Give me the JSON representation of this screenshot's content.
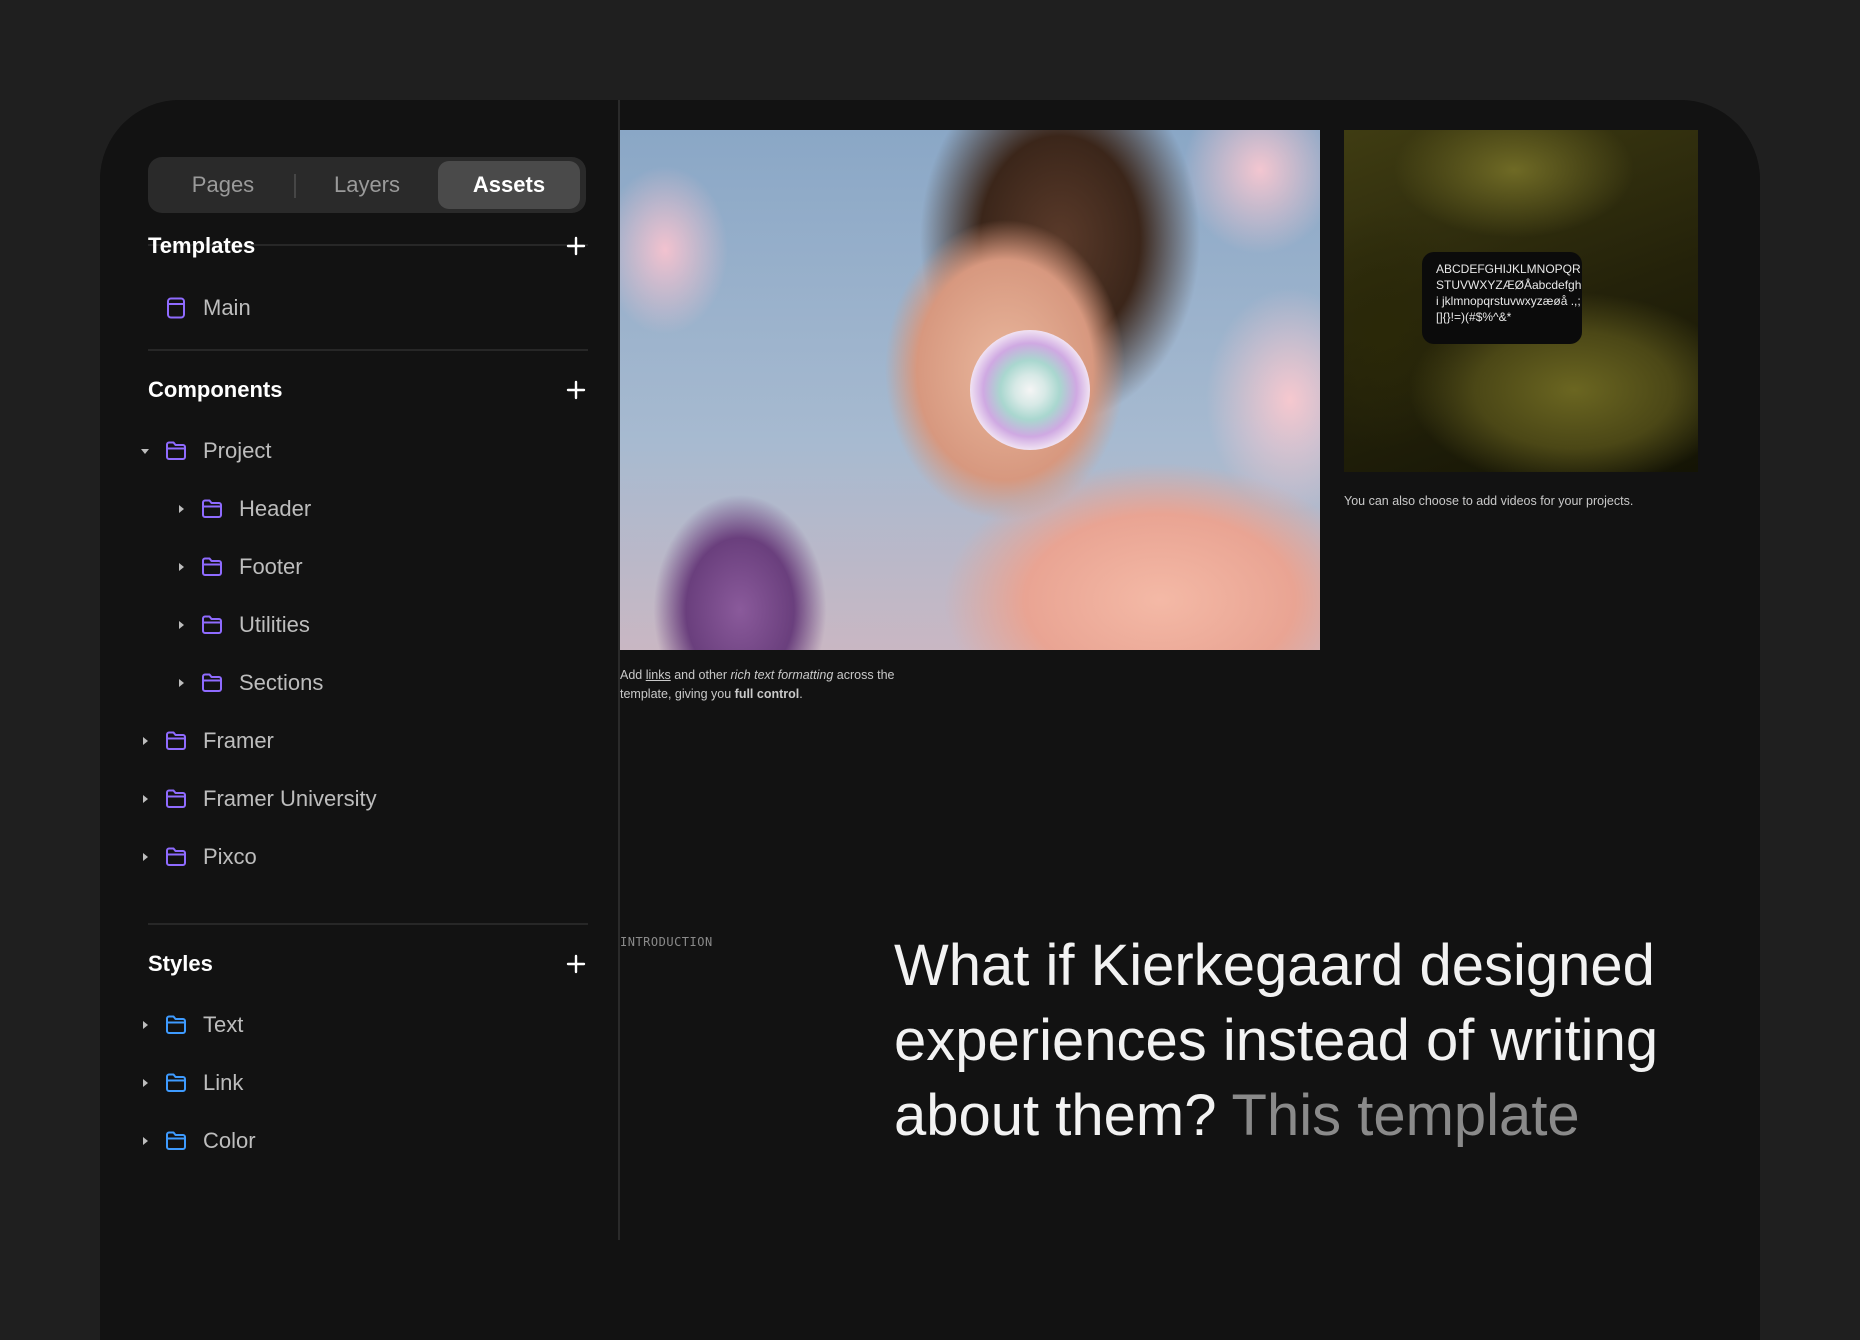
{
  "tabs": [
    "Pages",
    "Layers",
    "Assets"
  ],
  "active_tab": "Assets",
  "sections": {
    "templates": {
      "title": "Templates"
    },
    "components": {
      "title": "Components"
    },
    "styles": {
      "title": "Styles"
    }
  },
  "templates": [
    {
      "label": "Main",
      "icon": "page-icon"
    }
  ],
  "components": [
    {
      "label": "Project",
      "icon": "folder-icon",
      "expanded": true,
      "level": 1
    },
    {
      "label": "Header",
      "icon": "folder-icon",
      "expanded": false,
      "level": 2
    },
    {
      "label": "Footer",
      "icon": "folder-icon",
      "expanded": false,
      "level": 2
    },
    {
      "label": "Utilities",
      "icon": "folder-icon",
      "expanded": false,
      "level": 2
    },
    {
      "label": "Sections",
      "icon": "folder-icon",
      "expanded": false,
      "level": 2
    },
    {
      "label": "Framer",
      "icon": "folder-icon",
      "expanded": false,
      "level": 1
    },
    {
      "label": "Framer University",
      "icon": "folder-icon",
      "expanded": false,
      "level": 1
    },
    {
      "label": "Pixco",
      "icon": "folder-icon",
      "expanded": false,
      "level": 1
    }
  ],
  "styles": [
    {
      "label": "Text",
      "icon": "folder-icon"
    },
    {
      "label": "Link",
      "icon": "folder-icon"
    },
    {
      "label": "Color",
      "icon": "folder-icon"
    }
  ],
  "colors": {
    "component_icon": "#8f6bff",
    "style_icon": "#3e9bff",
    "background": "#121212"
  },
  "canvas": {
    "caption1": {
      "part1": "Add ",
      "link": "links",
      "part2": " and other ",
      "italic": "rich text formatting",
      "part3": " across the template, giving you ",
      "bold": "full control",
      "part4": "."
    },
    "glyph_sample": "ABCDEFGHIJKLMNOPQR STUVWXYZÆØÅabcdefghi jklmnopqrstuvwxyzæøå .,;[]{}!=)(#$%^&*",
    "caption2": "You can also choose to add videos for your projects.",
    "intro_label": "INTRODUCTION",
    "headline_main": "What if Kierkegaard designed experiences instead of writing about them?",
    "headline_muted": "This template"
  }
}
